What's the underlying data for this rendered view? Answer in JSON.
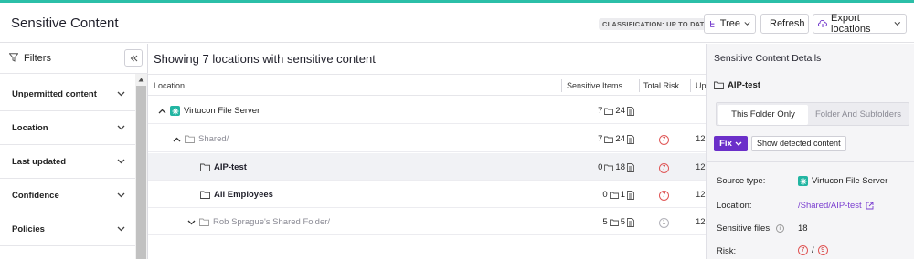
{
  "header": {
    "title": "Sensitive Content",
    "classification_badge": "CLASSIFICATION: UP TO DATE",
    "tree_label": "Tree",
    "refresh_label": "Refresh",
    "export_label": "Export locations"
  },
  "filters": {
    "title": "Filters",
    "items": [
      {
        "label": "Unpermitted content"
      },
      {
        "label": "Location"
      },
      {
        "label": "Last updated"
      },
      {
        "label": "Confidence"
      },
      {
        "label": "Policies"
      }
    ]
  },
  "main": {
    "heading": "Showing 7 locations with sensitive content",
    "columns": {
      "location": "Location",
      "sensitive_items": "Sensitive Items",
      "total_risk": "Total Risk",
      "updated": "Up"
    },
    "rows": [
      {
        "name": "Virtucon File Server",
        "folders": "7",
        "files": "24",
        "risk": "",
        "updated": "",
        "icon": "server-icon",
        "expander": "collapse"
      },
      {
        "name": "Shared/",
        "folders": "7",
        "files": "24",
        "risk": "7",
        "updated": "12,",
        "icon": "folder-icon",
        "expander": "collapse"
      },
      {
        "name": "AIP-test",
        "folders": "0",
        "files": "18",
        "risk": "7",
        "updated": "12,",
        "icon": "folder-icon",
        "expander": ""
      },
      {
        "name": "All Employees",
        "folders": "0",
        "files": "1",
        "risk": "7",
        "updated": "12,",
        "icon": "folder-icon",
        "expander": ""
      },
      {
        "name": "Rob Sprague's Shared Folder/",
        "folders": "5",
        "files": "5",
        "risk": "1",
        "updated": "12,",
        "icon": "folder-icon",
        "expander": "expand"
      }
    ]
  },
  "details": {
    "title": "Sensitive Content Details",
    "folder_name": "AIP-test",
    "tabs": {
      "this_folder": "This Folder Only",
      "subfolders": "Folder And Subfolders"
    },
    "fix_label": "Fix",
    "show_detected_label": "Show detected content",
    "source_type_label": "Source type:",
    "source_type_value": "Virtucon File Server",
    "location_label": "Location:",
    "location_value": "/Shared/AIP-test",
    "sensitive_files_label": "Sensitive files:",
    "sensitive_files_value": "18",
    "risk_label": "Risk:",
    "risk_value": "7",
    "risk_max": "9",
    "risk_sep": "/"
  },
  "colors": {
    "accent": "#2bbfa8",
    "fix_button": "#6b2fc9",
    "risk": "#d03030",
    "link": "#7b3fd0"
  }
}
